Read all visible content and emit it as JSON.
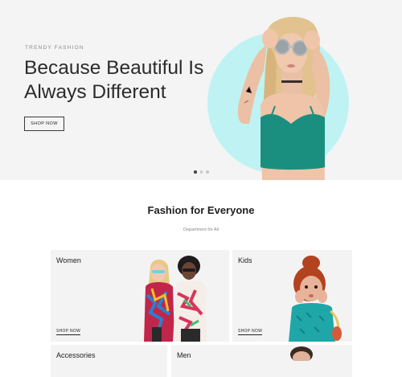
{
  "hero": {
    "eyebrow": "TRENDY FASHION",
    "headline_line1": "Because Beautiful Is",
    "headline_line2": "Always Different",
    "cta_label": "SHOP NOW",
    "accent_color": "#bff3f3",
    "slides_total": 3,
    "slide_active": 1
  },
  "section": {
    "title": "Fashion for Everyone",
    "subtitle": "Department for All"
  },
  "categories": [
    {
      "title": "Women",
      "link": "SHOP NOW"
    },
    {
      "title": "Kids",
      "link": "SHOP NOW"
    },
    {
      "title": "Accessories"
    },
    {
      "title": "Men"
    }
  ]
}
